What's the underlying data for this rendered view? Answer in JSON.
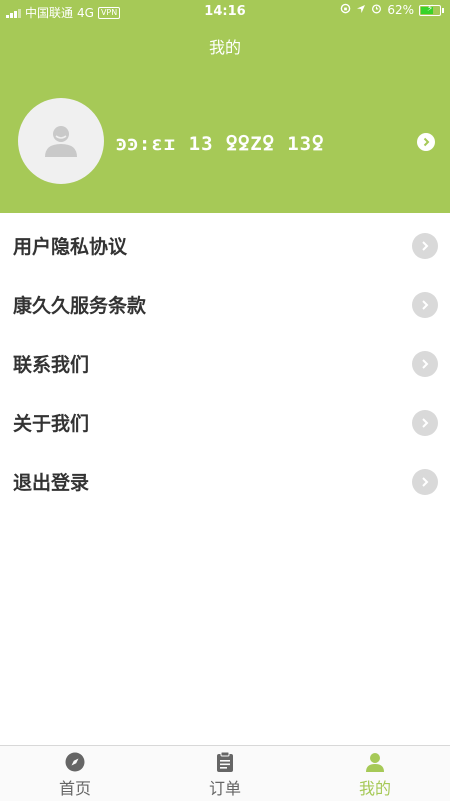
{
  "status_bar": {
    "carrier": "中国联通",
    "network": "4G",
    "vpn": "VPN",
    "time": "14:16",
    "battery": "62%"
  },
  "header": {
    "title": "我的",
    "profile_name": "ꜿꜿ:ɛɪ 13  ꝿꝿZꝿ 13ꝿ"
  },
  "menu": {
    "items": [
      {
        "label": "用户隐私协议"
      },
      {
        "label": "康久久服务条款"
      },
      {
        "label": "联系我们"
      },
      {
        "label": "关于我们"
      },
      {
        "label": "退出登录"
      }
    ]
  },
  "tabbar": {
    "tabs": [
      {
        "label": "首页",
        "icon": "compass-icon",
        "active": false
      },
      {
        "label": "订单",
        "icon": "clipboard-icon",
        "active": false
      },
      {
        "label": "我的",
        "icon": "user-icon",
        "active": true
      }
    ]
  },
  "colors": {
    "brand": "#a6c957",
    "text": "#333333",
    "arrow": "#d9d9d9"
  }
}
